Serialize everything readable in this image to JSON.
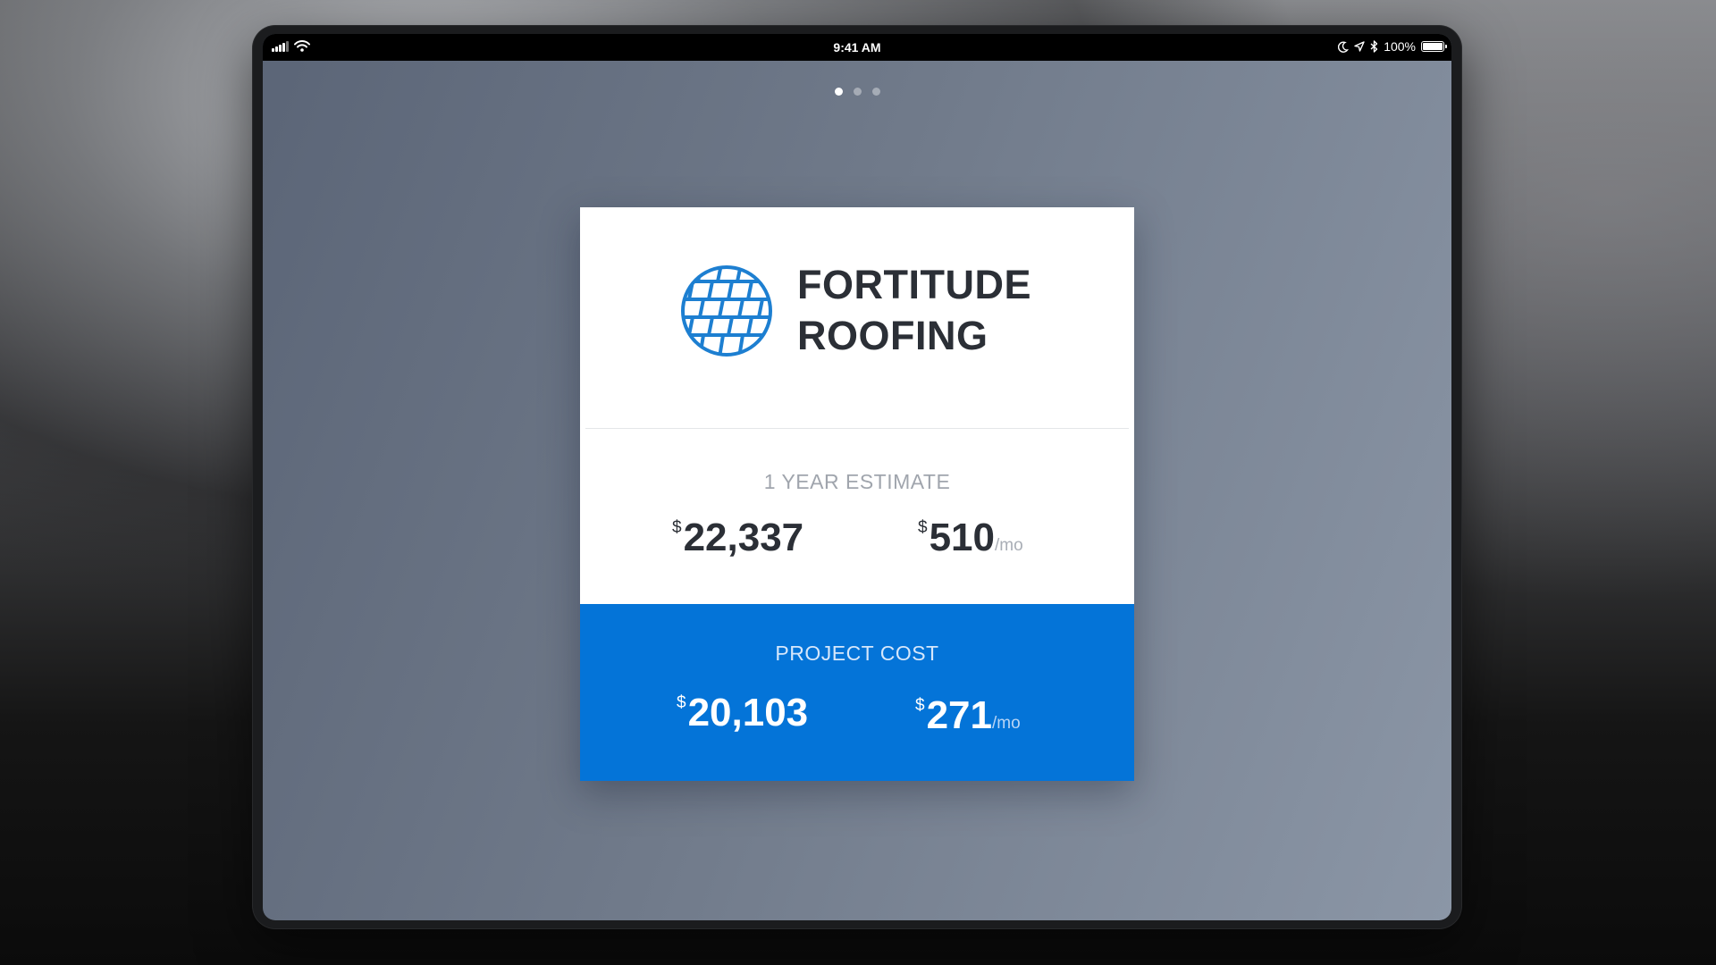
{
  "status_bar": {
    "time": "9:41 AM",
    "battery": "100%",
    "icons": [
      "signal-icon",
      "wifi-icon",
      "moon-icon",
      "location-icon",
      "bluetooth-icon",
      "battery-icon"
    ]
  },
  "pager": {
    "total": 3,
    "active_index": 0
  },
  "brand": {
    "name_line1": "FORTITUDE",
    "name_line2": "ROOFING",
    "logo_icon": "roof-tiles-globe-icon",
    "accent_color": "#1d7fd1"
  },
  "estimate": {
    "label": "1 YEAR ESTIMATE",
    "total_currency": "$",
    "total": "22,337",
    "monthly_currency": "$",
    "monthly": "510",
    "monthly_unit": "/mo"
  },
  "project_cost": {
    "label": "PROJECT COST",
    "total_currency": "$",
    "total": "20,103",
    "monthly_currency": "$",
    "monthly": "271",
    "monthly_unit": "/mo",
    "background_color": "#0474d8"
  }
}
